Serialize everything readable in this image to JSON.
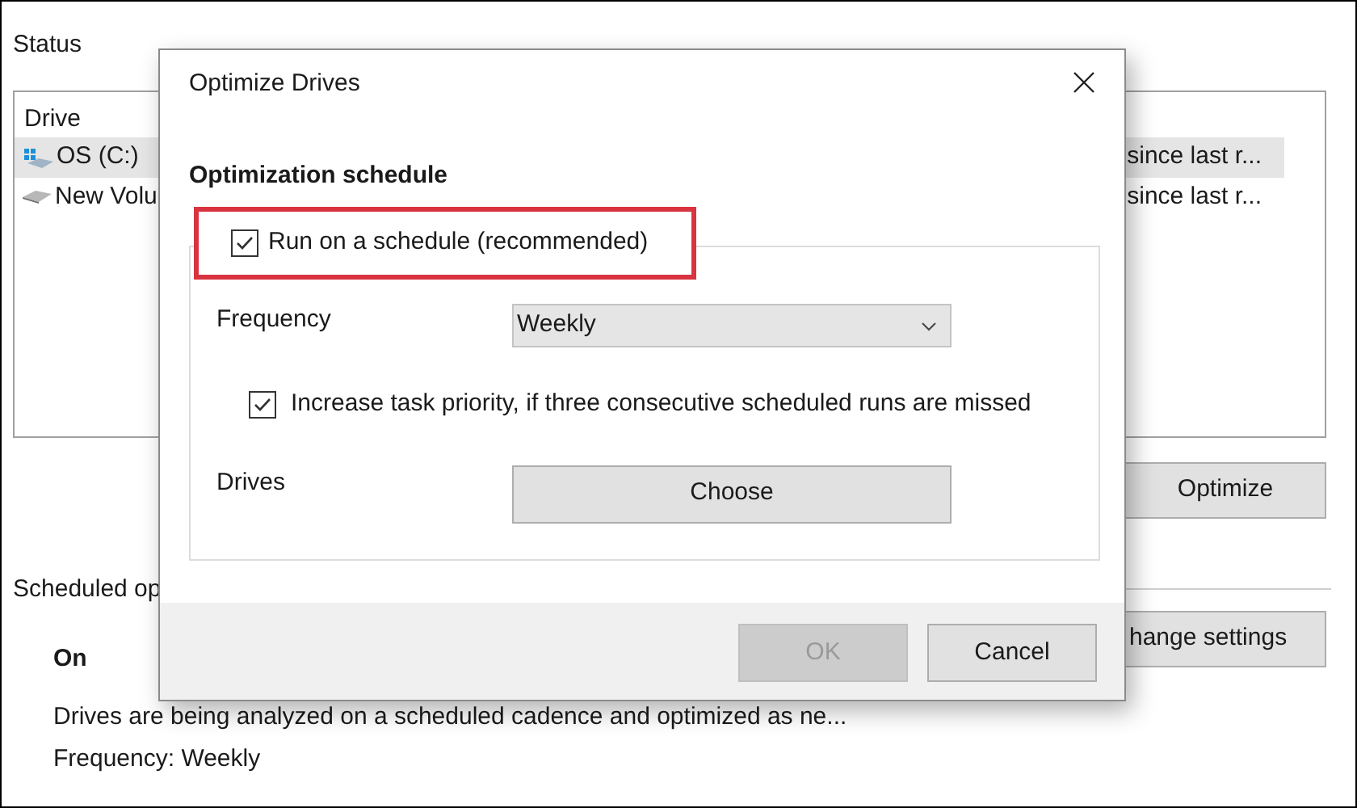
{
  "background_window": {
    "status_label": "Status",
    "drive_list": {
      "column_1": "Drive",
      "rows": [
        {
          "name": "OS (C:)",
          "column_2": "since last r...",
          "selected": true,
          "kind": "system"
        },
        {
          "name": "New Volu",
          "column_2": "since last r...",
          "selected": false,
          "kind": "data"
        }
      ]
    },
    "optimize_button": "Optimize",
    "scheduled_label": "Scheduled op",
    "change_settings_button": "hange settings",
    "schedule_state": "On",
    "schedule_description": "Drives are being analyzed on a scheduled cadence and optimized as ne...",
    "frequency_summary": "Frequency: Weekly"
  },
  "dialog": {
    "title": "Optimize Drives",
    "heading": "Optimization schedule",
    "run_on_schedule": {
      "label": "Run on a schedule (recommended)",
      "checked": true,
      "highlighted": true
    },
    "frequency": {
      "label": "Frequency",
      "value": "Weekly"
    },
    "increase_priority": {
      "label": "Increase task priority, if three consecutive scheduled runs are missed",
      "checked": true
    },
    "drives": {
      "label": "Drives",
      "button": "Choose"
    },
    "buttons": [
      {
        "label": "OK",
        "disabled": true
      },
      {
        "label": "Cancel",
        "disabled": false
      }
    ]
  }
}
